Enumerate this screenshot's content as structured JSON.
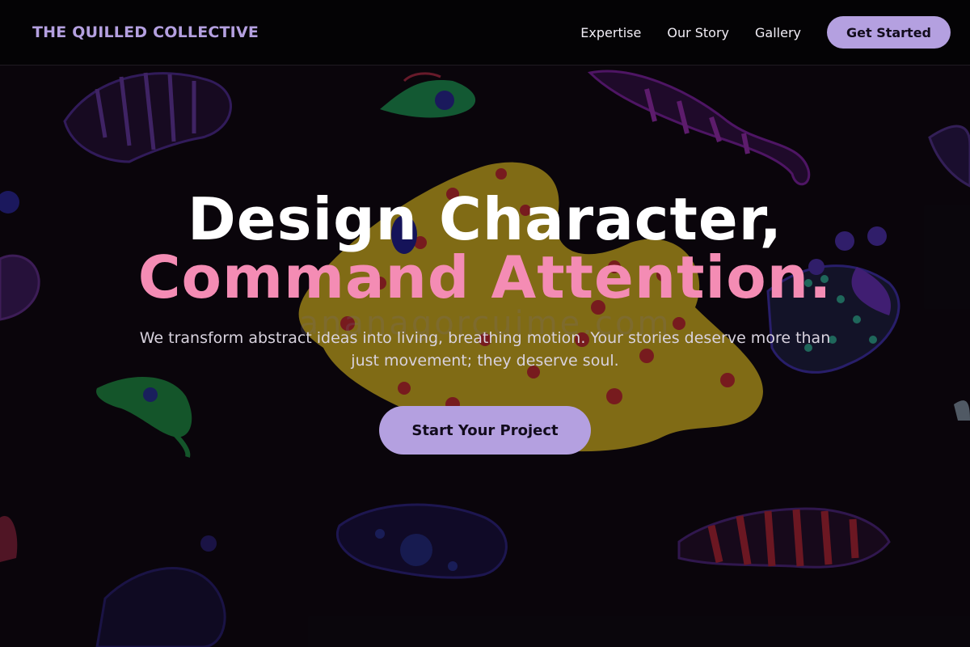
{
  "nav": {
    "brand": "THE QUILLED COLLECTIVE",
    "links": [
      "Expertise",
      "Our Story",
      "Gallery"
    ],
    "cta_label": "Get Started"
  },
  "hero": {
    "headline_line1": "Design Character,",
    "headline_line2": "Command Attention.",
    "subheading": "We transform abstract ideas into living, breathing motion. Your stories deserve more than just movement; they deserve soul.",
    "cta_label": "Start Your Project",
    "watermark": "ananagorcuime.com"
  },
  "colors": {
    "accent": "#b4a0e0",
    "highlight": "#f48cb4",
    "background": "#0a060c"
  },
  "icons": [
    "background-artwork"
  ]
}
